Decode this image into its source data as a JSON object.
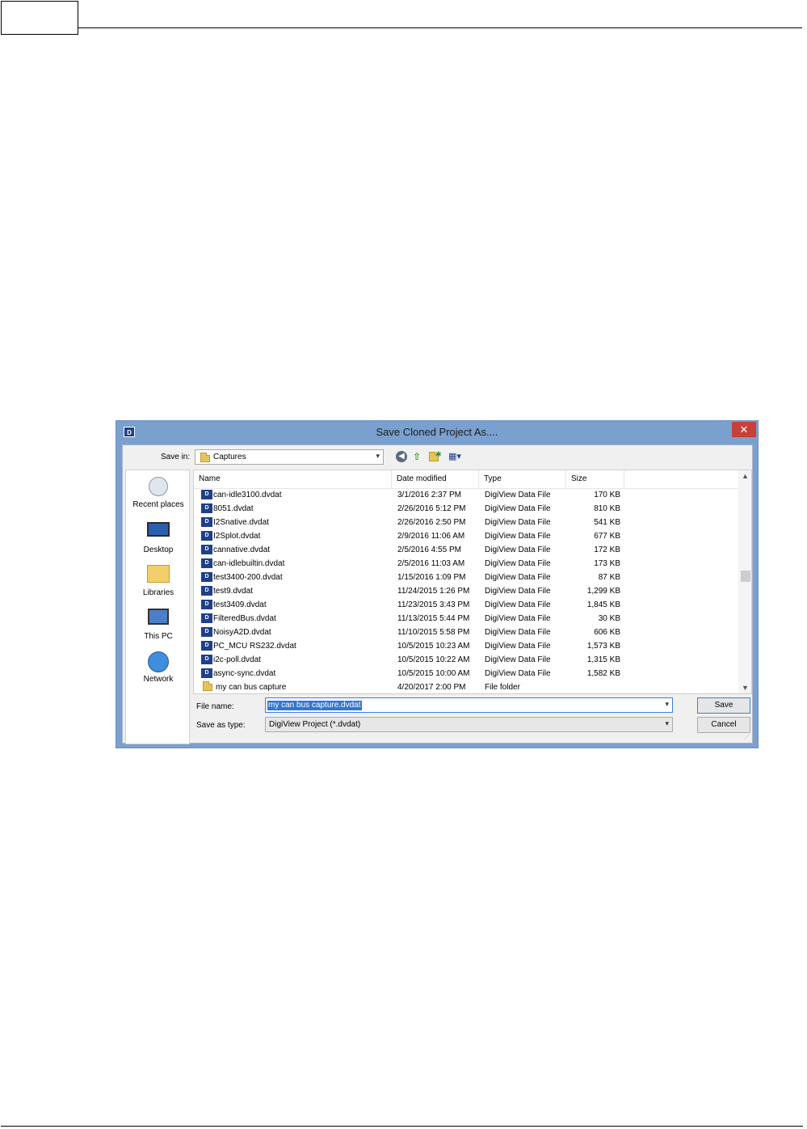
{
  "dialog": {
    "title": "Save Cloned Project As....",
    "app_icon": "digiview-app-icon",
    "close_label": "✕"
  },
  "save_in": {
    "label": "Save in:",
    "value": "Captures"
  },
  "toolbar": {
    "back_icon": "back-icon",
    "up_icon": "up-folder-icon",
    "new_folder_icon": "new-folder-icon",
    "views_icon": "views-menu-icon"
  },
  "places": [
    {
      "label": "Recent places",
      "icon": "recent-places-icon"
    },
    {
      "label": "Desktop",
      "icon": "desktop-icon"
    },
    {
      "label": "Libraries",
      "icon": "libraries-icon"
    },
    {
      "label": "This PC",
      "icon": "this-pc-icon"
    },
    {
      "label": "Network",
      "icon": "network-icon"
    }
  ],
  "columns": {
    "name": "Name",
    "date": "Date modified",
    "type": "Type",
    "size": "Size"
  },
  "files": [
    {
      "name": "can-idle3100.dvdat",
      "date": "3/1/2016 2:37 PM",
      "type": "DigiView Data File",
      "size": "170 KB"
    },
    {
      "name": "8051.dvdat",
      "date": "2/26/2016 5:12 PM",
      "type": "DigiView Data File",
      "size": "810 KB"
    },
    {
      "name": "I2Snative.dvdat",
      "date": "2/26/2016 2:50 PM",
      "type": "DigiView Data File",
      "size": "541 KB"
    },
    {
      "name": "I2Splot.dvdat",
      "date": "2/9/2016 11:06 AM",
      "type": "DigiView Data File",
      "size": "677 KB"
    },
    {
      "name": "cannative.dvdat",
      "date": "2/5/2016 4:55 PM",
      "type": "DigiView Data File",
      "size": "172 KB"
    },
    {
      "name": "can-idlebuiltin.dvdat",
      "date": "2/5/2016 11:03 AM",
      "type": "DigiView Data File",
      "size": "173 KB"
    },
    {
      "name": "test3400-200.dvdat",
      "date": "1/15/2016 1:09 PM",
      "type": "DigiView Data File",
      "size": "87 KB"
    },
    {
      "name": "test9.dvdat",
      "date": "11/24/2015 1:26 PM",
      "type": "DigiView Data File",
      "size": "1,299 KB"
    },
    {
      "name": "test3409.dvdat",
      "date": "11/23/2015 3:43 PM",
      "type": "DigiView Data File",
      "size": "1,845 KB"
    },
    {
      "name": "FilteredBus.dvdat",
      "date": "11/13/2015 5:44 PM",
      "type": "DigiView Data File",
      "size": "30 KB"
    },
    {
      "name": "NoisyA2D.dvdat",
      "date": "11/10/2015 5:58 PM",
      "type": "DigiView Data File",
      "size": "606 KB"
    },
    {
      "name": "PC_MCU RS232.dvdat",
      "date": "10/5/2015 10:23 AM",
      "type": "DigiView Data File",
      "size": "1,573 KB"
    },
    {
      "name": "i2c-poll.dvdat",
      "date": "10/5/2015 10:22 AM",
      "type": "DigiView Data File",
      "size": "1,315 KB"
    },
    {
      "name": "async-sync.dvdat",
      "date": "10/5/2015 10:00 AM",
      "type": "DigiView Data File",
      "size": "1,582 KB"
    },
    {
      "name": "my can bus capture",
      "date": "4/20/2017 2:00 PM",
      "type": "File folder",
      "size": "",
      "folder": true
    }
  ],
  "file_name": {
    "label": "File name:",
    "value": "my can bus capture.dvdat"
  },
  "save_as_type": {
    "label": "Save as type:",
    "value": "DigiView Project (*.dvdat)"
  },
  "buttons": {
    "save": "Save",
    "cancel": "Cancel"
  },
  "colors": {
    "title_bar": "#7aa0cf",
    "close_button": "#c7403a",
    "selection": "#3377cc",
    "file_icon": "#1e3f8a"
  }
}
